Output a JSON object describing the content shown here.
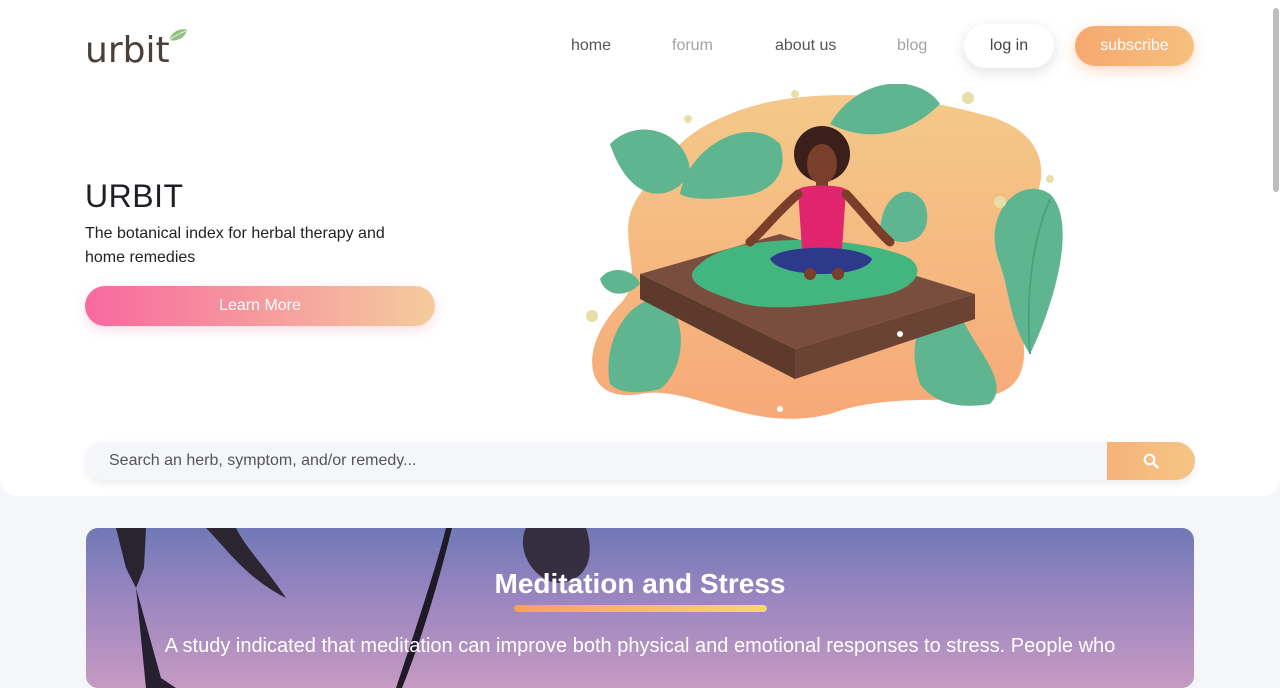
{
  "brand": {
    "logo_text": "urbit",
    "logo_icon": "leaf-icon"
  },
  "nav": {
    "items": [
      {
        "label": "home",
        "state": "active"
      },
      {
        "label": "forum",
        "state": "muted"
      },
      {
        "label": "about us",
        "state": "normal"
      },
      {
        "label": "blog",
        "state": "muted"
      }
    ],
    "login_label": "log in",
    "subscribe_label": "subscribe"
  },
  "hero": {
    "title": "URBIT",
    "subtitle": "The botanical index for herbal therapy and home remedies",
    "cta_label": "Learn More"
  },
  "search": {
    "placeholder": "Search an herb, symptom, and/or remedy...",
    "value": "",
    "button_icon": "search-icon"
  },
  "article": {
    "title": "Meditation and Stress",
    "text": "A study indicated that meditation can improve both physical and emotional responses to stress. People who"
  },
  "colors": {
    "accent_orange": "#f6b27a",
    "accent_pink": "#f868a0",
    "leaf_green": "#5db38c",
    "page_bg": "#f4f6f9"
  }
}
